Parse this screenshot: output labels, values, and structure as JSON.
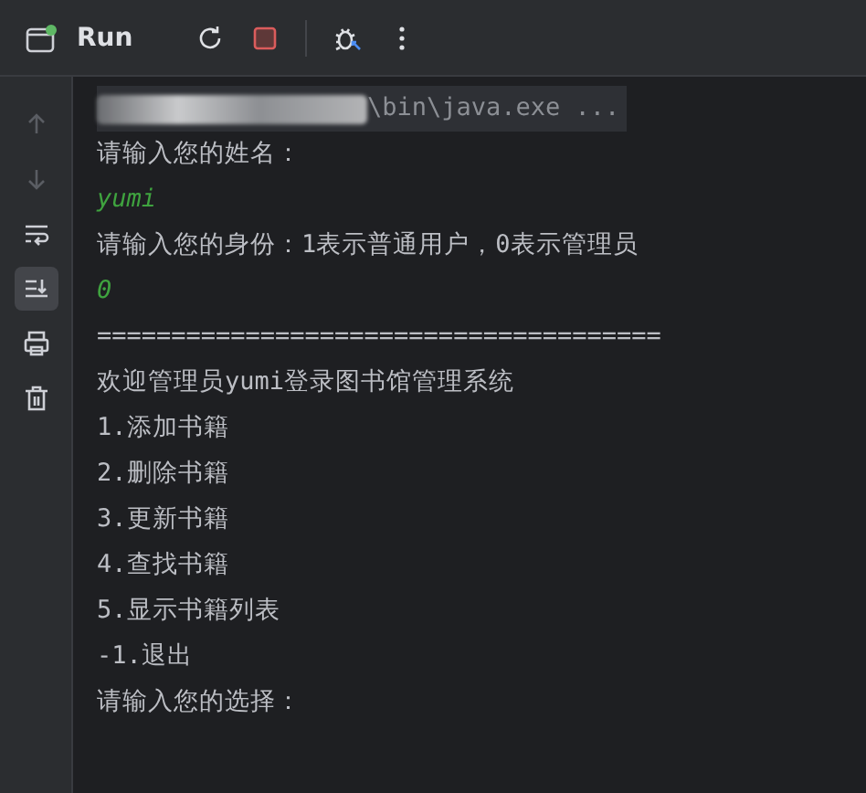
{
  "toolbar": {
    "title": "Run",
    "running": true
  },
  "gutter_tools": [
    {
      "kind": "up",
      "disabled": true,
      "selected": false
    },
    {
      "kind": "down",
      "disabled": true,
      "selected": false
    },
    {
      "kind": "wrap",
      "disabled": false,
      "selected": false
    },
    {
      "kind": "scroll-end",
      "disabled": false,
      "selected": true
    },
    {
      "kind": "print",
      "disabled": false,
      "selected": false
    },
    {
      "kind": "trash",
      "disabled": false,
      "selected": false
    }
  ],
  "console_lines": [
    {
      "kind": "command",
      "text": "\\bin\\java.exe ..."
    },
    {
      "kind": "output",
      "text": "请输入您的姓名："
    },
    {
      "kind": "input",
      "text": "yumi"
    },
    {
      "kind": "output",
      "text": "请输入您的身份：1表示普通用户，0表示管理员"
    },
    {
      "kind": "input",
      "text": "0"
    },
    {
      "kind": "output",
      "text": "======================================"
    },
    {
      "kind": "output",
      "text": "欢迎管理员yumi登录图书馆管理系统"
    },
    {
      "kind": "output",
      "text": "1.添加书籍"
    },
    {
      "kind": "output",
      "text": "2.删除书籍"
    },
    {
      "kind": "output",
      "text": "3.更新书籍"
    },
    {
      "kind": "output",
      "text": "4.查找书籍"
    },
    {
      "kind": "output",
      "text": "5.显示书籍列表"
    },
    {
      "kind": "output",
      "text": "-1.退出"
    },
    {
      "kind": "output",
      "text": "请输入您的选择："
    }
  ]
}
